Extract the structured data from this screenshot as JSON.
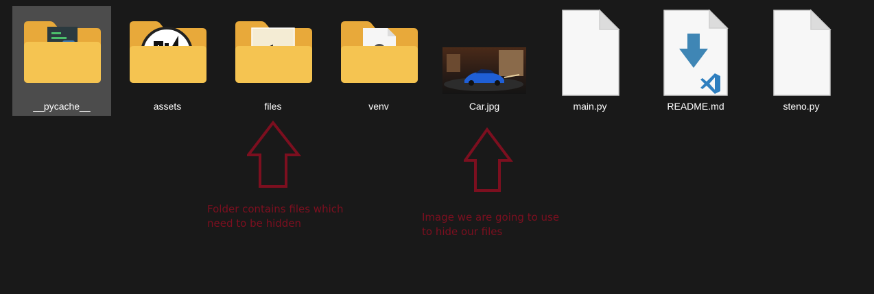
{
  "items": [
    {
      "label": "__pycache__",
      "kind": "folder",
      "selected": true
    },
    {
      "label": "assets",
      "kind": "folder"
    },
    {
      "label": "files",
      "kind": "folder"
    },
    {
      "label": "venv",
      "kind": "folder"
    },
    {
      "label": "Car.jpg",
      "kind": "image"
    },
    {
      "label": "main.py",
      "kind": "file"
    },
    {
      "label": "README.md",
      "kind": "vscode-file"
    },
    {
      "label": "steno.py",
      "kind": "file"
    }
  ],
  "annotations": [
    {
      "line1": "Folder contains files which",
      "line2": "need to be hidden"
    },
    {
      "line1": "Image we are going to use",
      "line2": "to hide our files"
    }
  ],
  "colors": {
    "background": "#191919",
    "folder": "#f5c451",
    "folder_dark": "#e8a93a",
    "annotation": "#7c0f1f",
    "vscode_blue": "#2f7fbf",
    "download_arrow": "#3f86b5"
  },
  "icons": [
    "folder-icon",
    "image-thumbnail",
    "file-icon",
    "vscode-icon",
    "down-arrow-icon",
    "up-arrow-icon"
  ]
}
